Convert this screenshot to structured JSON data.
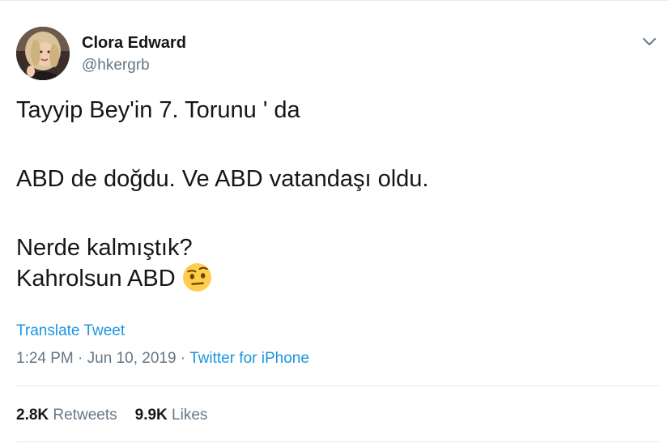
{
  "author": {
    "name": "Clora Edward",
    "handle": "@hkergrb"
  },
  "tweet": {
    "lines": [
      "Tayyip Bey'in 7. Torunu ' da",
      "ABD de doğdu. Ve ABD vatandaşı oldu.",
      "Nerde kalmıştık?",
      "Kahrolsun ABD"
    ],
    "emoji": "face-with-raised-eyebrow-icon"
  },
  "translate_label": "Translate Tweet",
  "meta": {
    "time": "1:24 PM",
    "separator": " · ",
    "date": "Jun 10, 2019",
    "source": "Twitter for iPhone"
  },
  "stats": {
    "retweets_count": "2.8K",
    "retweets_label": "Retweets",
    "likes_count": "9.9K",
    "likes_label": "Likes"
  },
  "colors": {
    "link": "#1b95e0",
    "text": "#14171a",
    "secondary": "#657786",
    "divider": "#e6ecf0"
  }
}
